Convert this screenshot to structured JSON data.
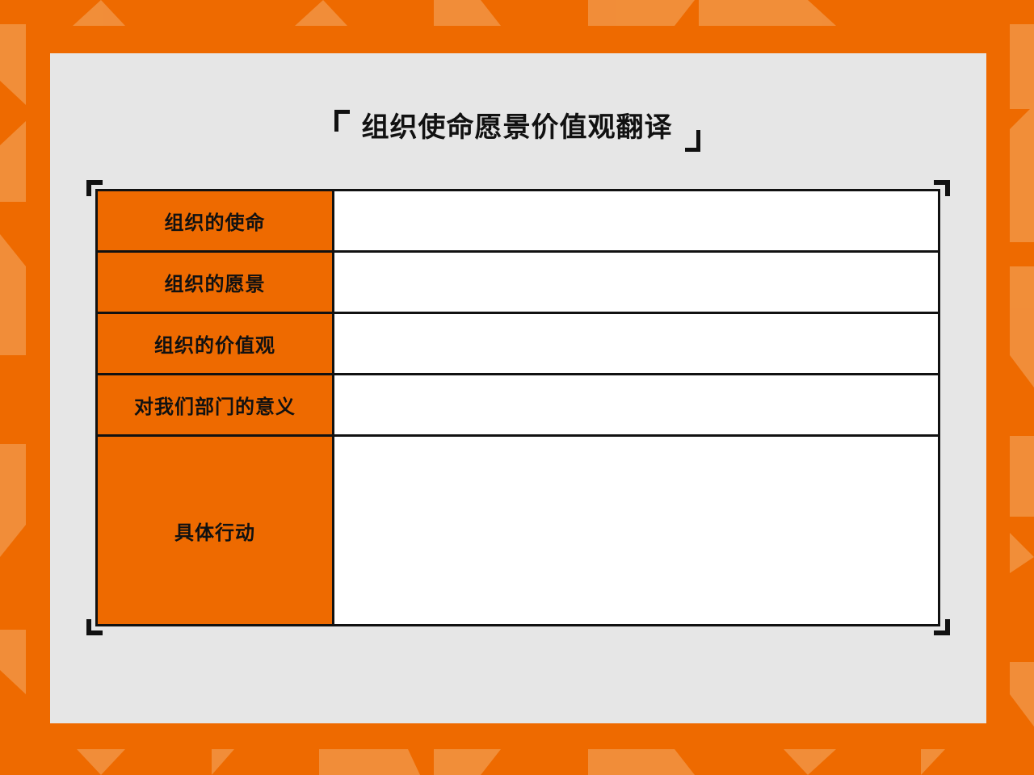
{
  "title": "组织使命愿景价值观翻译",
  "rows": [
    {
      "label": "组织的使命",
      "value": ""
    },
    {
      "label": "组织的愿景",
      "value": ""
    },
    {
      "label": "组织的价值观",
      "value": ""
    },
    {
      "label": "对我们部门的意义",
      "value": ""
    },
    {
      "label": "具体行动",
      "value": ""
    }
  ],
  "colors": {
    "accent": "#ee6a00",
    "accent_light": "#f29a4c",
    "panel": "#e6e6e6",
    "border": "#111111",
    "cell": "#ffffff"
  }
}
